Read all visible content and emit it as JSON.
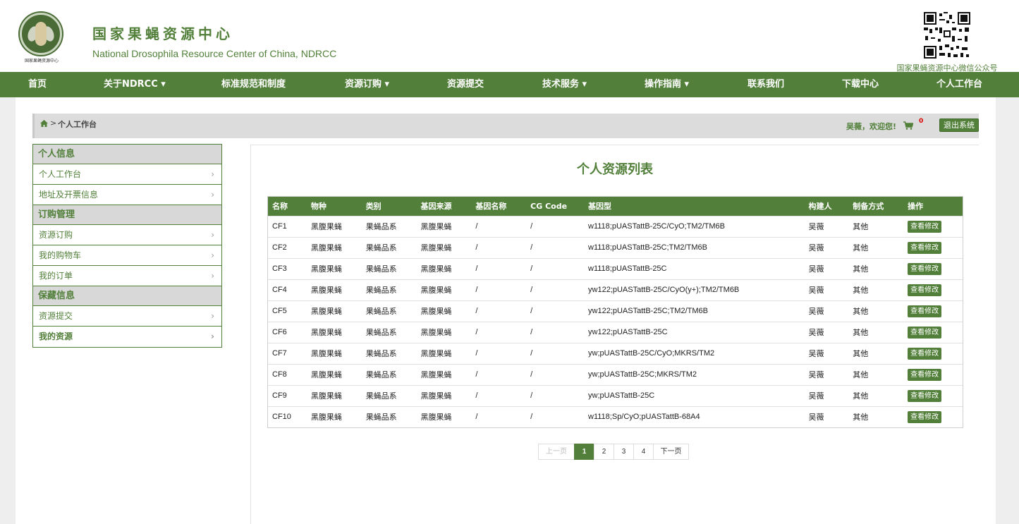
{
  "header": {
    "title_cn": "国家果蝇资源中心",
    "title_en": "National Drosophila Resource Center of China, NDRCC",
    "logo_caption": "国家果蝇资源中心",
    "qr_caption": "国家果蝇资源中心微信公众号"
  },
  "nav": {
    "items": [
      {
        "label": "首页"
      },
      {
        "label": "关于NDRCC ▾"
      },
      {
        "label": "标准规范和制度"
      },
      {
        "label": "资源订购 ▾"
      },
      {
        "label": "资源提交"
      },
      {
        "label": "技术服务 ▾"
      },
      {
        "label": "操作指南 ▾"
      },
      {
        "label": "联系我们"
      },
      {
        "label": "下载中心"
      },
      {
        "label": "个人工作台"
      }
    ]
  },
  "breadcrumb": {
    "separator": ">",
    "current": "个人工作台",
    "welcome": "吴薇，欢迎您!",
    "cart_count": "0",
    "logout_label": "退出系统"
  },
  "sidebar": {
    "groups": [
      {
        "title": "个人信息",
        "items": [
          "个人工作台",
          "地址及开票信息"
        ]
      },
      {
        "title": "订购管理",
        "items": [
          "资源订购",
          "我的购物车",
          "我的订单"
        ]
      },
      {
        "title": "保藏信息",
        "items": [
          "资源提交",
          "我的资源"
        ]
      }
    ],
    "chevron": "›"
  },
  "content": {
    "title": "个人资源列表",
    "columns": [
      "名称",
      "物种",
      "类别",
      "基因来源",
      "基因名称",
      "CG Code",
      "基因型",
      "构建人",
      "制备方式",
      "操作"
    ],
    "edit_label": "查看修改",
    "rows": [
      [
        "CF1",
        "黑腹果蝇",
        "果蝇品系",
        "黑腹果蝇",
        "/",
        "/",
        "w1118;pUASTattB-25C/CyO;TM2/TM6B",
        "吴薇",
        "其他"
      ],
      [
        "CF2",
        "黑腹果蝇",
        "果蝇品系",
        "黑腹果蝇",
        "/",
        "/",
        "w1118;pUASTattB-25C;TM2/TM6B",
        "吴薇",
        "其他"
      ],
      [
        "CF3",
        "黑腹果蝇",
        "果蝇品系",
        "黑腹果蝇",
        "/",
        "/",
        "w1118;pUASTattB-25C",
        "吴薇",
        "其他"
      ],
      [
        "CF4",
        "黑腹果蝇",
        "果蝇品系",
        "黑腹果蝇",
        "/",
        "/",
        "yw122;pUASTattB-25C/CyO(y+);TM2/TM6B",
        "吴薇",
        "其他"
      ],
      [
        "CF5",
        "黑腹果蝇",
        "果蝇品系",
        "黑腹果蝇",
        "/",
        "/",
        "yw122;pUASTattB-25C;TM2/TM6B",
        "吴薇",
        "其他"
      ],
      [
        "CF6",
        "黑腹果蝇",
        "果蝇品系",
        "黑腹果蝇",
        "/",
        "/",
        "yw122;pUASTattB-25C",
        "吴薇",
        "其他"
      ],
      [
        "CF7",
        "黑腹果蝇",
        "果蝇品系",
        "黑腹果蝇",
        "/",
        "/",
        "yw;pUASTattB-25C/CyO;MKRS/TM2",
        "吴薇",
        "其他"
      ],
      [
        "CF8",
        "黑腹果蝇",
        "果蝇品系",
        "黑腹果蝇",
        "/",
        "/",
        "yw;pUASTattB-25C;MKRS/TM2",
        "吴薇",
        "其他"
      ],
      [
        "CF9",
        "黑腹果蝇",
        "果蝇品系",
        "黑腹果蝇",
        "/",
        "/",
        "yw;pUASTattB-25C",
        "吴薇",
        "其他"
      ],
      [
        "CF10",
        "黑腹果蝇",
        "果蝇品系",
        "黑腹果蝇",
        "/",
        "/",
        "w1118;Sp/CyO;pUASTattB-68A4",
        "吴薇",
        "其他"
      ]
    ]
  },
  "pagination": {
    "prev": "上一页",
    "pages": [
      "1",
      "2",
      "3",
      "4"
    ],
    "current": "1",
    "next": "下一页"
  },
  "colors": {
    "brand_green": "#52803a",
    "background": "#eeeeee",
    "panel": "#ffffff"
  }
}
